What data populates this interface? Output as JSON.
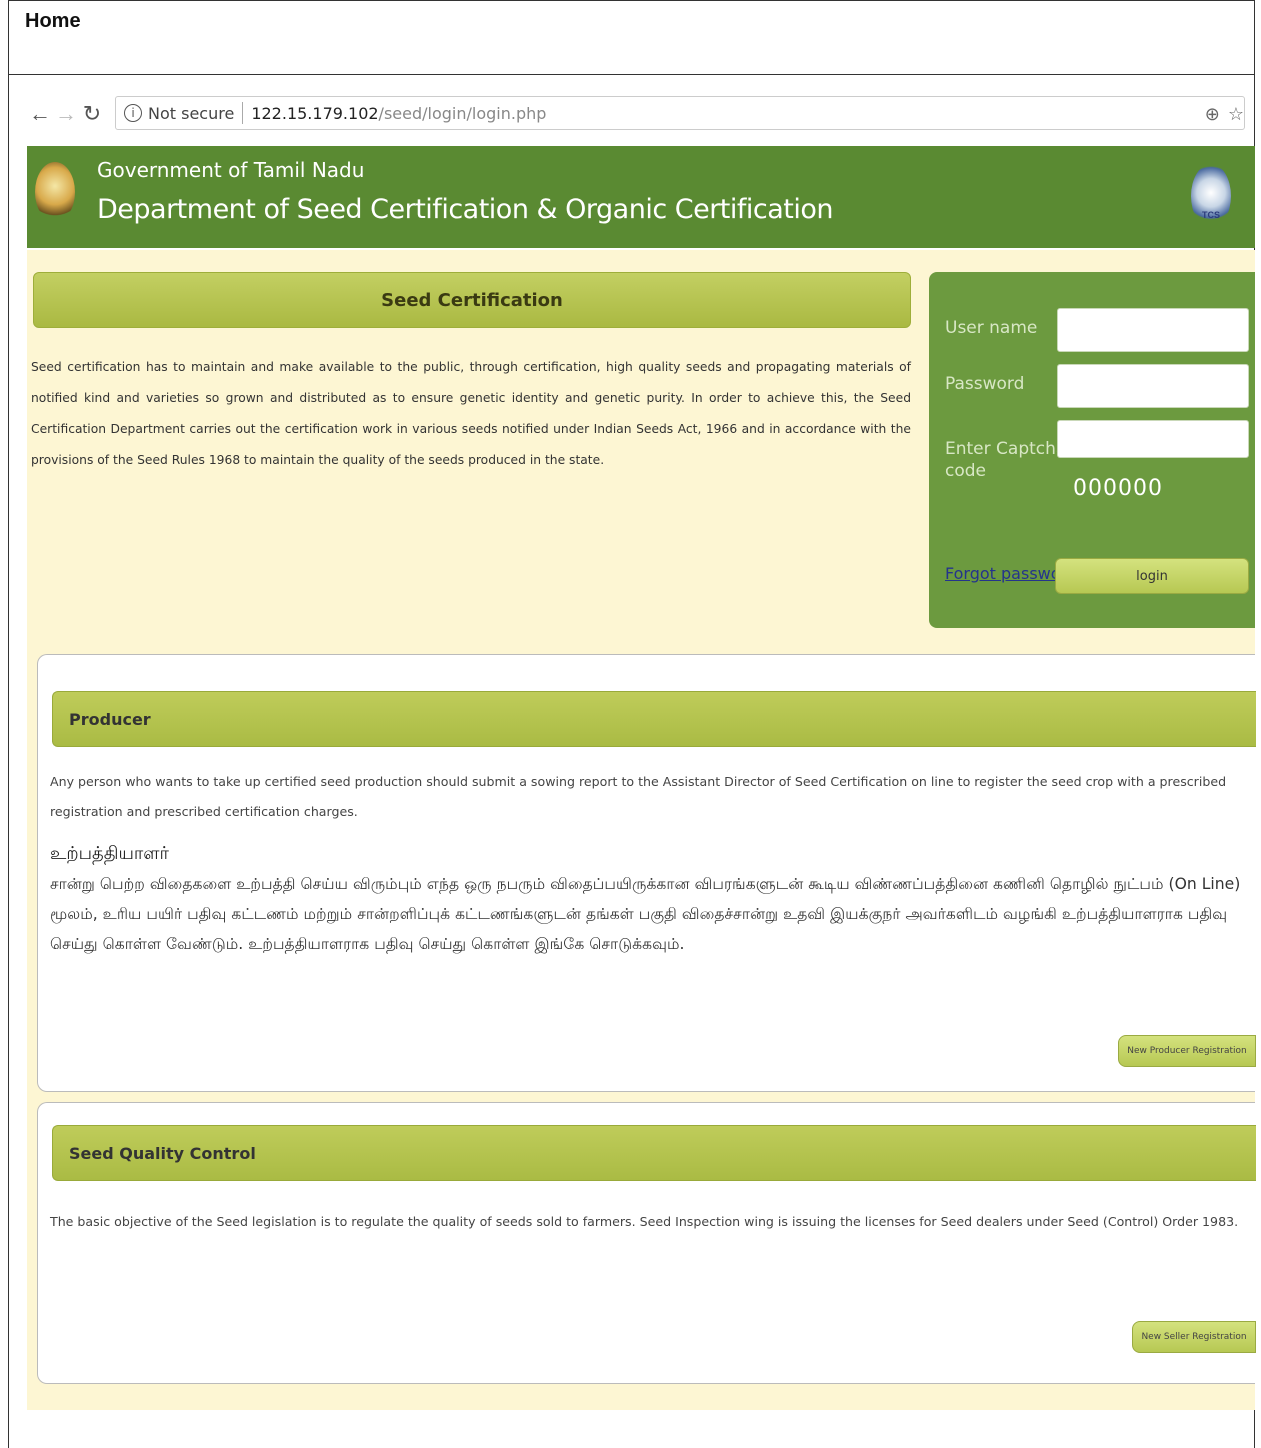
{
  "document": {
    "title": "Home"
  },
  "browser": {
    "security_label": "Not secure",
    "url_host": "122.15.179.102",
    "url_path": "/seed/login/login.php"
  },
  "header": {
    "government": "Government of Tamil Nadu",
    "department": "Department of Seed Certification & Organic Certification",
    "emblem_right_text": "TCS"
  },
  "seed_certification": {
    "title": "Seed Certification",
    "description": "Seed certification has to maintain and make available to the public, through certification, high quality seeds and propagating materials of notified kind and varieties so grown and distributed as to ensure genetic identity and genetic purity. In order to achieve this, the Seed Certification Department carries out the certification work in various seeds notified under Indian Seeds Act, 1966 and in accordance with the provisions of the Seed Rules 1968 to maintain the quality of the seeds produced in the state."
  },
  "login": {
    "username_label": "User name",
    "password_label": "Password",
    "captcha_label_line1": "Enter Captcha",
    "captcha_label_line2": "code",
    "captcha_value": "000000",
    "forgot_password": "Forgot password",
    "login_button": "login"
  },
  "producer": {
    "title": "Producer",
    "description": "Any person who wants to take up certified seed production should submit a sowing report to the Assistant Director of Seed Certification on line to register the seed crop with a prescribed registration and prescribed certification charges.",
    "tamil_heading": "உற்பத்தியாளர்",
    "tamil_text": "சான்று பெற்ற விதைகளை உற்பத்தி செய்ய விரும்பும் எந்த ஒரு நபரும் விதைப்பயிருக்கான விபரங்களுடன் கூடிய விண்ணப்பத்தினை கணினி தொழில் நுட்பம் (On Line) மூலம், உரிய பயிர் பதிவு கட்டணம் மற்றும் சான்றளிப்புக் கட்டணங்களுடன் தங்கள் பகுதி விதைச்சான்று உதவி இயக்குநர் அவர்களிடம் வழங்கி உற்பத்தியாளராக பதிவு செய்து கொள்ள வேண்டும். உற்பத்தியாளராக பதிவு செய்து கொள்ள இங்கே சொடுக்கவும்.",
    "button": "New Producer Registration"
  },
  "seed_quality": {
    "title": "Seed Quality Control",
    "description": "The basic objective of the Seed legislation is to regulate the quality of seeds sold to farmers. Seed Inspection wing is issuing the licenses for Seed dealers under Seed (Control) Order 1983.",
    "button": "New Seller Registration"
  }
}
